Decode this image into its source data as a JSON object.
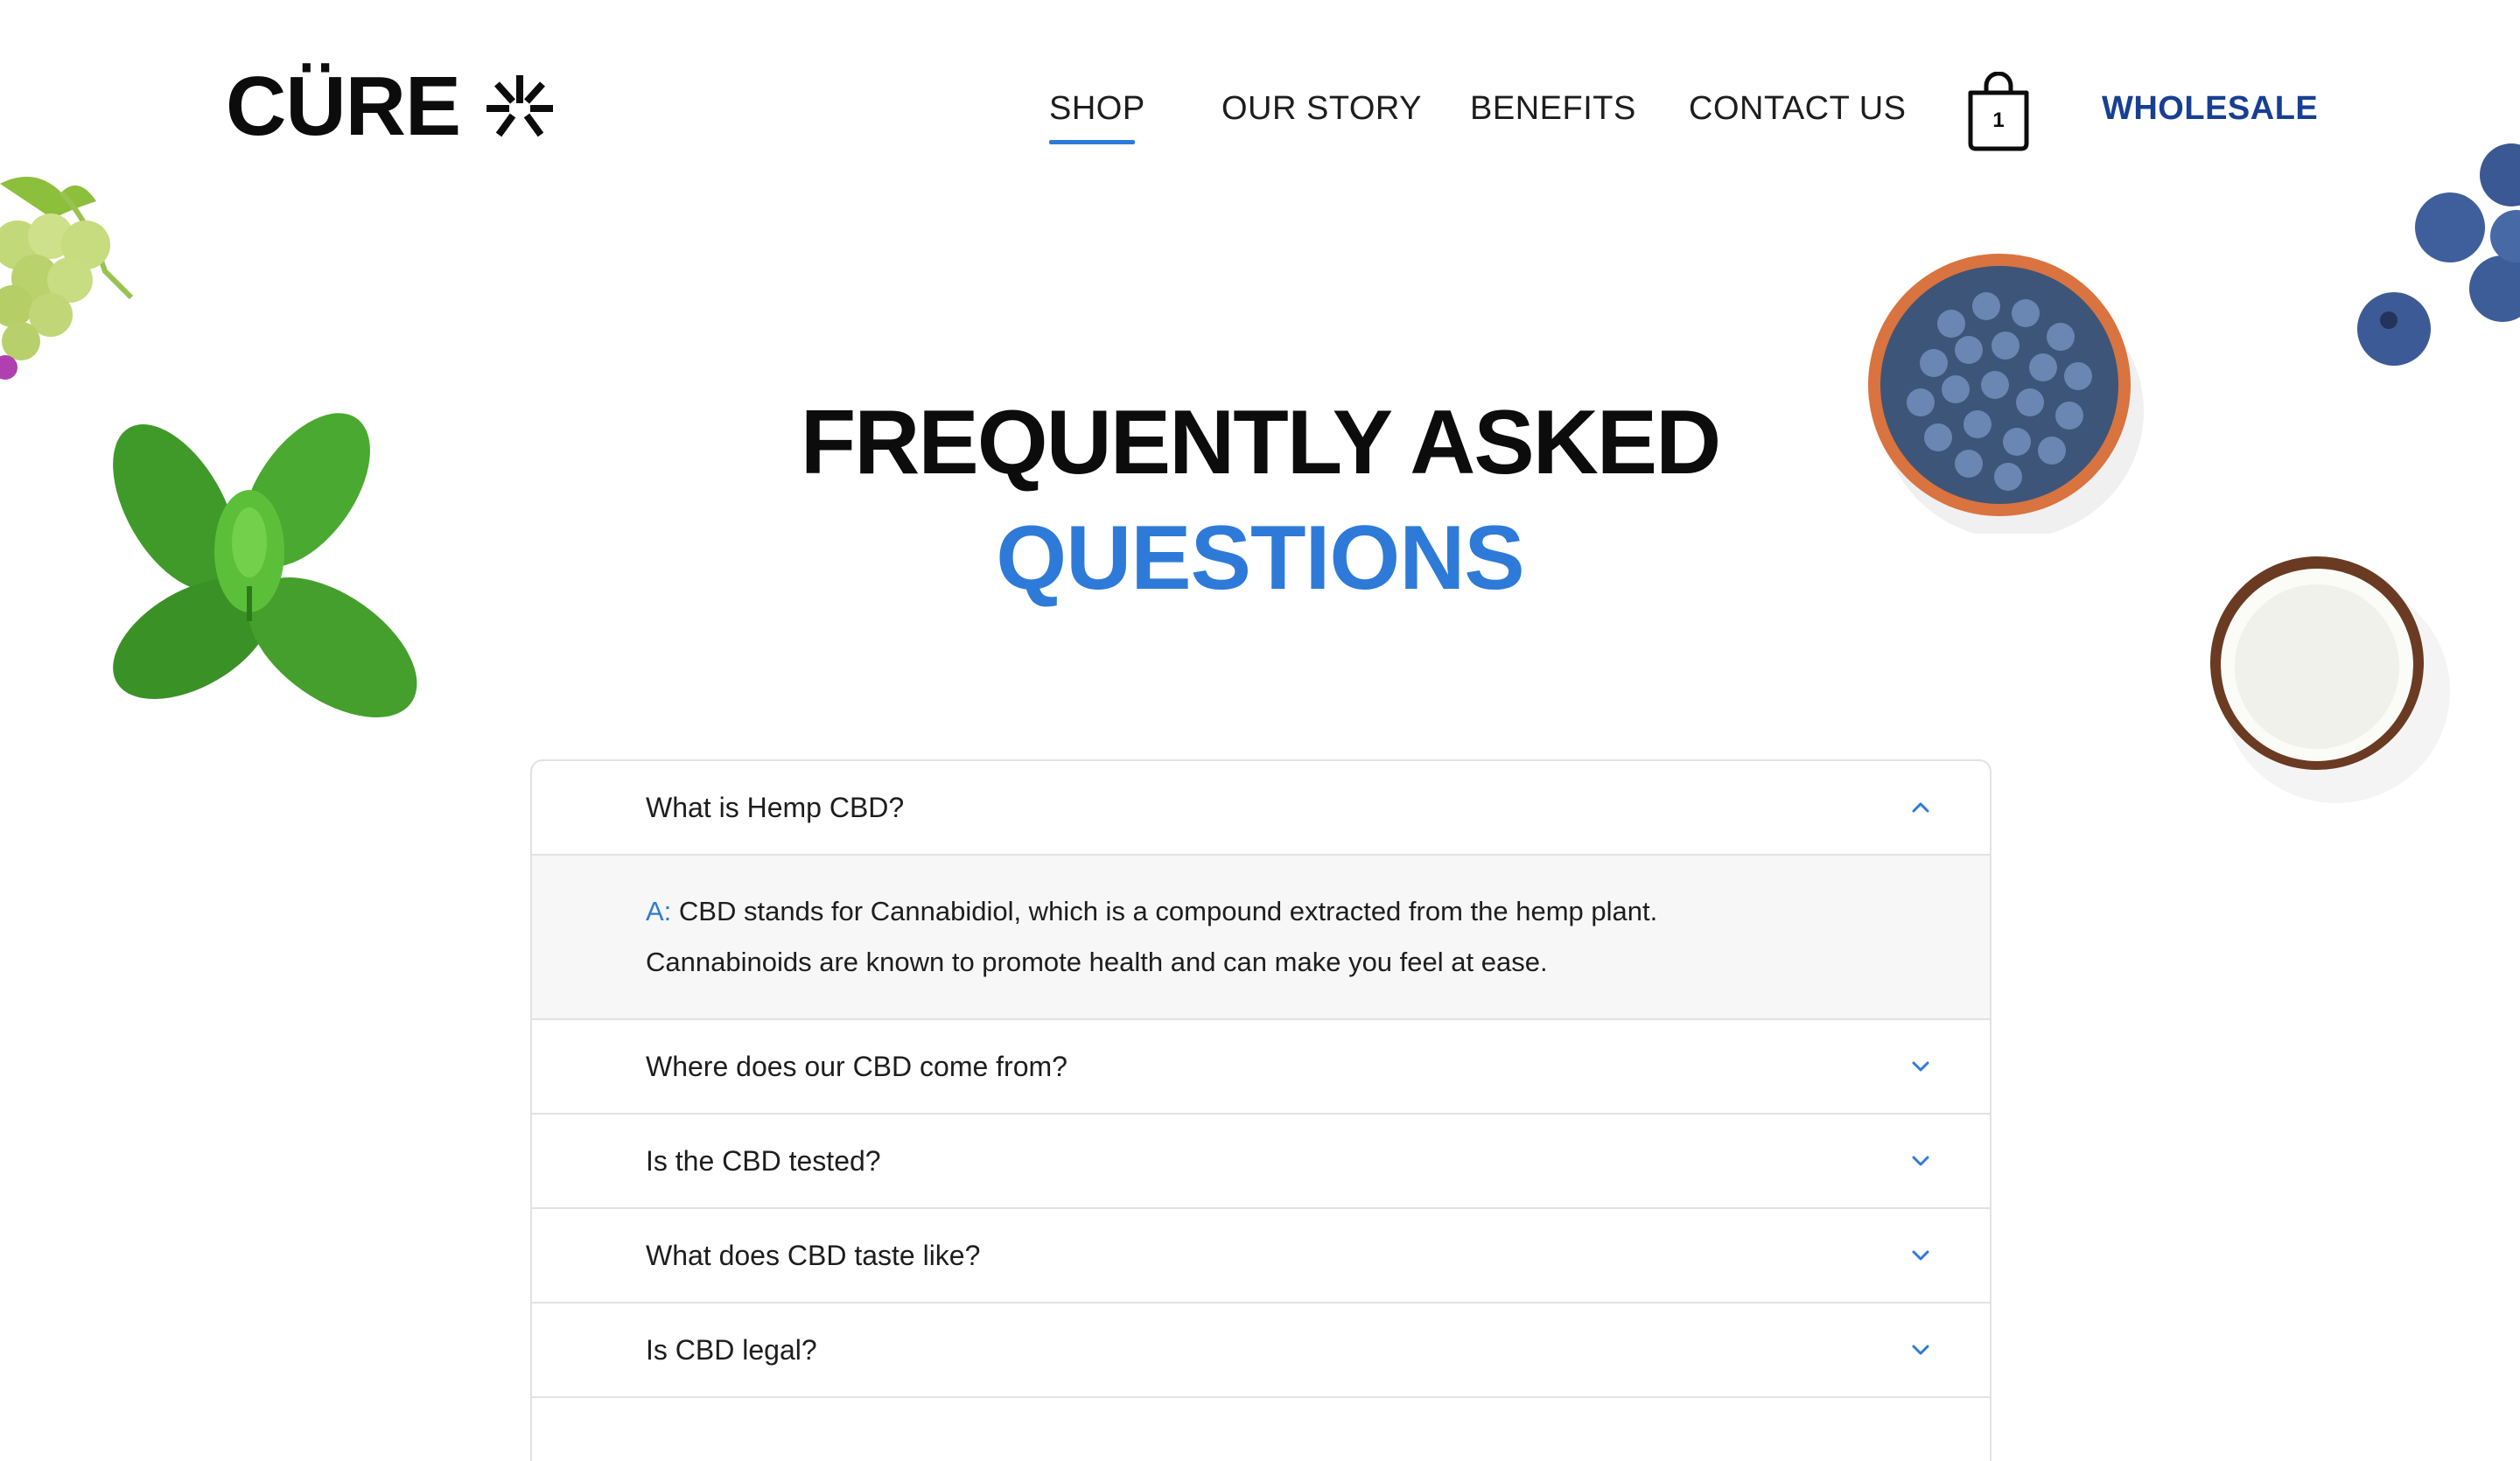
{
  "brand": {
    "name": "CÜRE"
  },
  "nav": {
    "shop": "SHOP",
    "our_story": "OUR STORY",
    "benefits": "BENEFITS",
    "contact_us": "CONTACT US",
    "wholesale": "WHOLESALE",
    "active": "SHOP",
    "cart_count": "1"
  },
  "hero": {
    "title_line1": "FREQUENTLY ASKED",
    "title_line2": "QUESTIONS"
  },
  "faq": {
    "items": [
      {
        "question": "What is Hemp CBD?",
        "expanded": true,
        "icon": "chevron-up-icon"
      },
      {
        "question": "Where does our CBD come from?",
        "expanded": false,
        "icon": "chevron-down-icon"
      },
      {
        "question": "Is the CBD tested?",
        "expanded": false,
        "icon": "chevron-down-icon"
      },
      {
        "question": "What does CBD taste like?",
        "expanded": false,
        "icon": "chevron-down-icon"
      },
      {
        "question": "Is CBD legal?",
        "expanded": false,
        "icon": "chevron-down-icon"
      }
    ],
    "answer": {
      "prefix": "A:",
      "line1": "CBD stands for Cannabidiol, which is a compound extracted from the hemp plant.",
      "line2": "Cannabinoids are known to promote health and can make you feel at ease."
    }
  },
  "colors": {
    "accent": "#2e7ad8",
    "wholesale": "#173f93",
    "text": "#1d1d1d",
    "border": "#e2e2e2",
    "answer_bg": "#f7f7f7"
  },
  "decorations": [
    "grapes-image",
    "mint-leaves-image",
    "blueberry-bowl-image",
    "blueberries-image",
    "coconut-image"
  ]
}
